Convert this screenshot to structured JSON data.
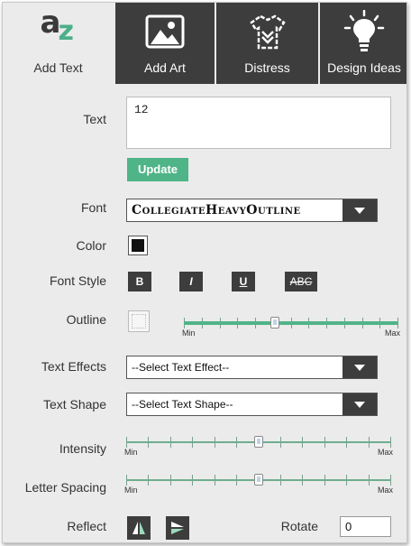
{
  "tabs": [
    {
      "label": "Add Text",
      "icon": "az-text-icon",
      "active": true
    },
    {
      "label": "Add Art",
      "icon": "image-icon",
      "active": false
    },
    {
      "label": "Distress",
      "icon": "shirt-icon",
      "active": false
    },
    {
      "label": "Design Ideas",
      "icon": "lightbulb-icon",
      "active": false
    }
  ],
  "text": {
    "label": "Text",
    "value": "12"
  },
  "update_label": "Update",
  "font": {
    "label": "Font",
    "value": "CollegiateHeavyOutline"
  },
  "color": {
    "label": "Color",
    "value": "#111111"
  },
  "font_style": {
    "label": "Font Style",
    "bold": "B",
    "italic": "I",
    "underline": "U",
    "strike": "ABC"
  },
  "outline": {
    "label": "Outline",
    "min": "Min",
    "max": "Max",
    "level": 0.42
  },
  "text_effects": {
    "label": "Text Effects",
    "value": "--Select Text Effect--"
  },
  "text_shape": {
    "label": "Text Shape",
    "value": "--Select Text Shape--"
  },
  "intensity": {
    "label": "Intensity",
    "min": "Min",
    "max": "Max",
    "level": 0.5
  },
  "letter_spacing": {
    "label": "Letter Spacing",
    "min": "Min",
    "max": "Max",
    "level": 0.5
  },
  "reflect": {
    "label": "Reflect"
  },
  "rotate": {
    "label": "Rotate",
    "value": "0"
  },
  "colors": {
    "accent": "#4fb487",
    "dark": "#3d3d3d",
    "panel": "#ebebeb"
  }
}
